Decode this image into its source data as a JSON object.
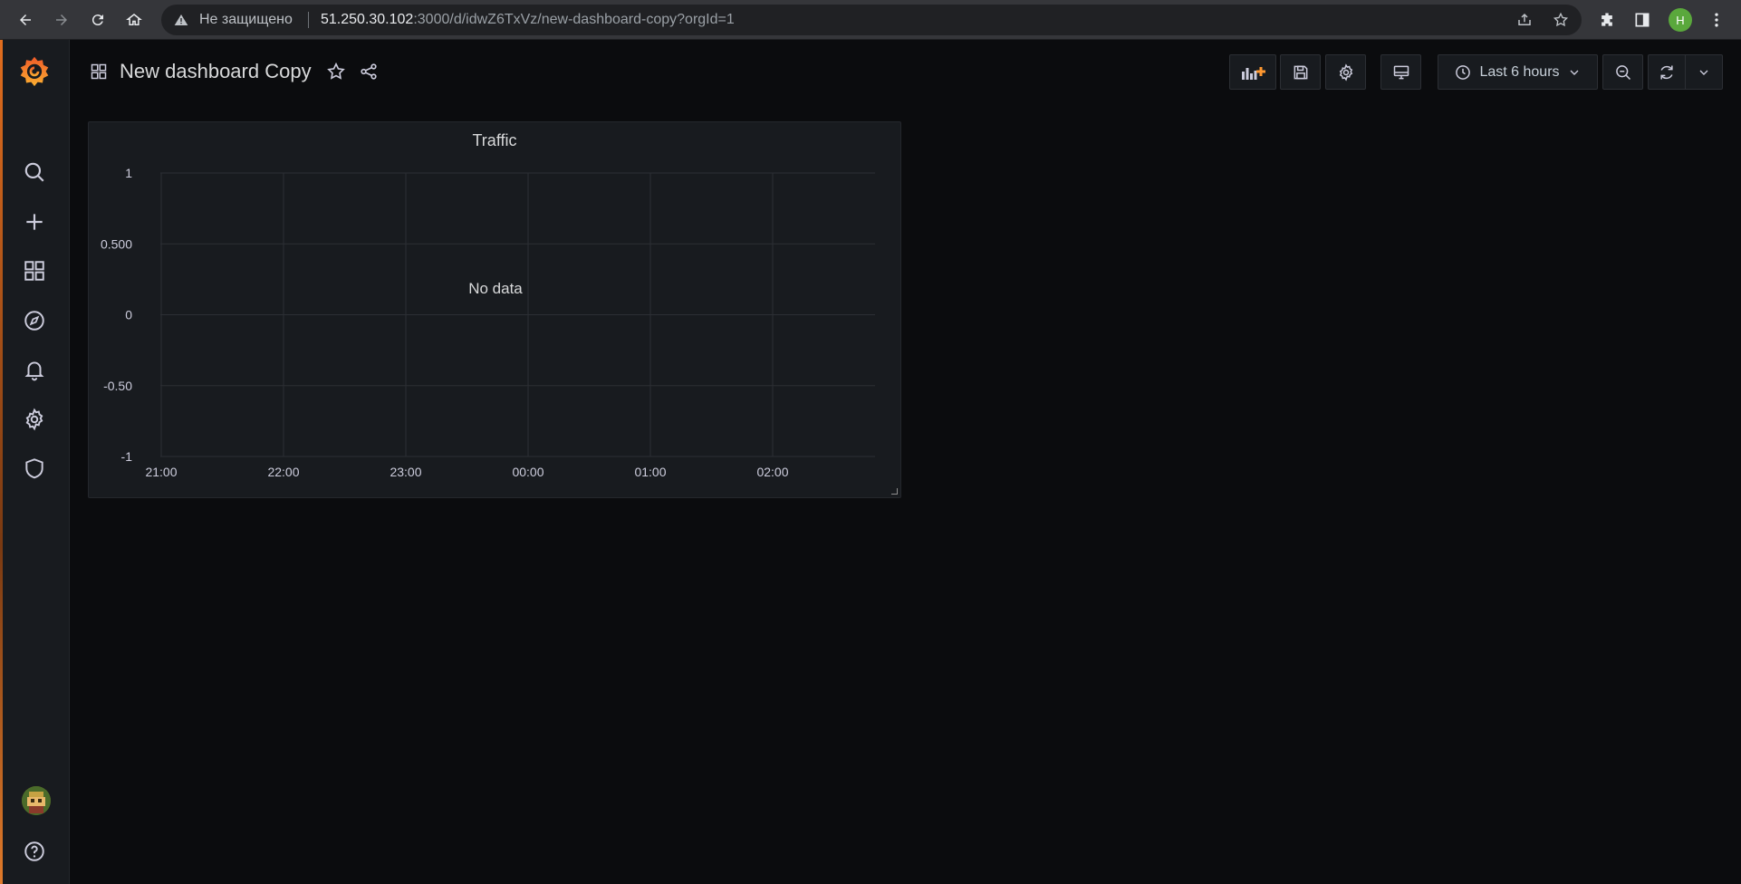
{
  "browser": {
    "security_label": "Не защищено",
    "url_host": "51.250.30.102",
    "url_path": ":3000/d/idwZ6TxVz/new-dashboard-copy?orgId=1",
    "profile_initial": "H",
    "profile_color": "#5aa83c"
  },
  "sidebar": {
    "items": [
      {
        "name": "search-icon"
      },
      {
        "name": "plus-icon"
      },
      {
        "name": "dashboards-icon"
      },
      {
        "name": "explore-compass-icon"
      },
      {
        "name": "alerting-bell-icon"
      },
      {
        "name": "configuration-gear-icon"
      },
      {
        "name": "server-admin-shield-icon"
      }
    ],
    "bottom": [
      {
        "name": "user-avatar"
      },
      {
        "name": "help-icon"
      }
    ]
  },
  "dashboard": {
    "title": "New dashboard Copy",
    "time_range": "Last 6 hours"
  },
  "toolbar": {
    "buttons": [
      "add-panel-icon",
      "save-icon",
      "settings-gear-icon",
      "tv-mode-icon",
      "clock-icon",
      "zoom-out-icon",
      "refresh-icon",
      "chevron-down-icon"
    ],
    "accent_color": "#ff9830"
  },
  "panel": {
    "title": "Traffic",
    "message": "No data"
  },
  "chart_data": {
    "type": "line",
    "title": "Traffic",
    "x": [
      "21:00",
      "22:00",
      "23:00",
      "00:00",
      "01:00",
      "02:00"
    ],
    "series": [],
    "y_ticks": [
      "1",
      "0.500",
      "0",
      "-0.50",
      "-1"
    ],
    "ylim": [
      -1,
      1
    ],
    "grid": true,
    "annotation": "No data"
  }
}
